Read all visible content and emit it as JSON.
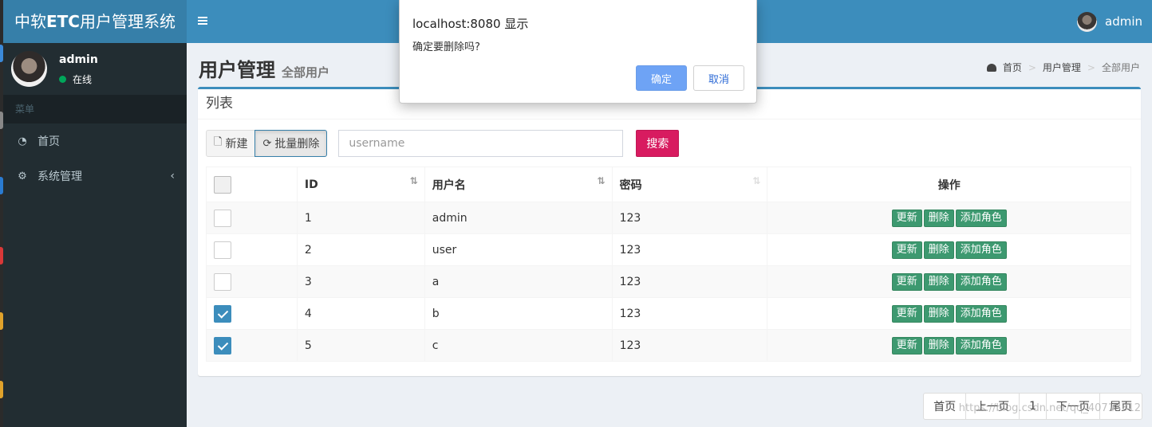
{
  "header": {
    "logo_pre": "中软",
    "logo_bold": "ETC",
    "logo_post": "用户管理系统",
    "user": "admin"
  },
  "sidebar": {
    "user_name": "admin",
    "status": "在线",
    "menu_header": "菜单",
    "items": [
      {
        "label": "首页",
        "icon": "dashboard-icon"
      },
      {
        "label": "系统管理",
        "icon": "cogs-icon"
      }
    ]
  },
  "page": {
    "title": "用户管理",
    "subtitle": "全部用户",
    "breadcrumb": [
      "首页",
      "用户管理",
      "全部用户"
    ]
  },
  "box": {
    "title": "列表",
    "new_label": "新建",
    "batch_delete_label": "批量删除",
    "search_placeholder": "username",
    "search_label": "搜索"
  },
  "table": {
    "columns": [
      "ID",
      "用户名",
      "密码",
      "操作"
    ],
    "rows": [
      {
        "id": "1",
        "username": "admin",
        "password": "123",
        "checked": false
      },
      {
        "id": "2",
        "username": "user",
        "password": "123",
        "checked": false
      },
      {
        "id": "3",
        "username": "a",
        "password": "123",
        "checked": false
      },
      {
        "id": "4",
        "username": "b",
        "password": "123",
        "checked": true
      },
      {
        "id": "5",
        "username": "c",
        "password": "123",
        "checked": true
      }
    ],
    "actions": [
      "更新",
      "删除",
      "添加角色"
    ]
  },
  "pagination": [
    "首页",
    "上一页",
    "1",
    "下一页",
    "尾页"
  ],
  "watermark": "https://blog.csdn.net/qq_40718312",
  "dialog": {
    "title": "localhost:8080 显示",
    "message": "确定要删除吗?",
    "ok_label": "确定",
    "cancel_label": "取消"
  },
  "colors": {
    "header_blue": "#3c8dbc",
    "sidebar_dark": "#222d32",
    "search_pink": "#d81b60",
    "action_green": "#3d9970",
    "dialog_ok": "#6ea3f5"
  }
}
